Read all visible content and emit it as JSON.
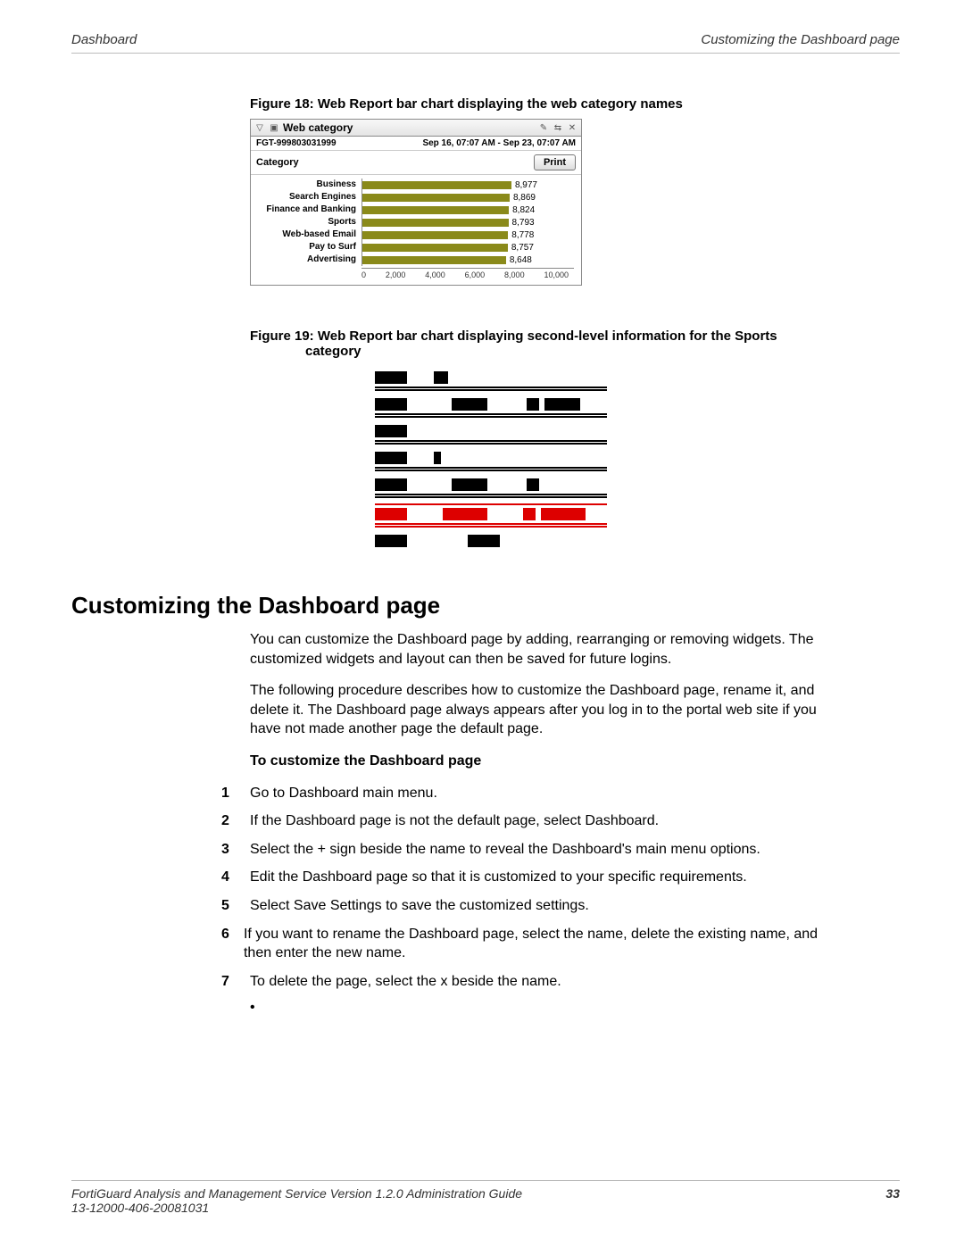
{
  "header": {
    "left": "Dashboard",
    "right": "Customizing the Dashboard page"
  },
  "figure18": {
    "caption": "Figure 18: Web Report bar chart displaying the web category names",
    "widget_title": "Web category",
    "device_id": "FGT-999803031999",
    "date_range": "Sep 16, 07:07 AM - Sep 23, 07:07 AM",
    "category_label": "Category",
    "print_label": "Print"
  },
  "chart_data": {
    "type": "bar",
    "orientation": "horizontal",
    "title": "Web category",
    "xlabel": "",
    "ylabel": "",
    "xlim": [
      0,
      10000
    ],
    "ticks": [
      "0",
      "2,000",
      "4,000",
      "6,000",
      "8,000",
      "10,000"
    ],
    "categories": [
      "Business",
      "Search Engines",
      "Finance and Banking",
      "Sports",
      "Web-based Email",
      "Pay to Surf",
      "Advertising"
    ],
    "values": [
      8977,
      8869,
      8824,
      8793,
      8778,
      8757,
      8648
    ],
    "value_labels": [
      "8,977",
      "8,869",
      "8,824",
      "8,793",
      "8,778",
      "8,757",
      "8,648"
    ]
  },
  "figure19": {
    "caption_line1": "Figure 19: Web Report bar chart displaying second-level information for the Sports",
    "caption_line2": "category"
  },
  "section": {
    "heading": "Customizing the Dashboard page",
    "para1": "You can customize the Dashboard page by adding, rearranging or removing widgets. The customized widgets and layout can then be saved for future logins.",
    "para2": "The following procedure describes how to customize the Dashboard page, rename it, and delete it. The Dashboard page always appears after you log in to the portal web site if you have not made another page the default page.",
    "subhead": "To customize the Dashboard page",
    "steps": [
      "Go to Dashboard main menu.",
      "If the Dashboard page is not the default page, select Dashboard.",
      "Select the + sign beside the name to reveal the Dashboard's main menu options.",
      "Edit the Dashboard page so that it is customized to your specific requirements.",
      "Select Save Settings to save the customized settings.",
      "If you want to rename the Dashboard page, select the name, delete the existing name, and then enter the new name.",
      "To delete the page, select the x beside the name."
    ]
  },
  "footer": {
    "line1": "FortiGuard Analysis and Management Service Version 1.2.0 Administration Guide",
    "line2": "13-12000-406-20081031",
    "page_number": "33"
  }
}
